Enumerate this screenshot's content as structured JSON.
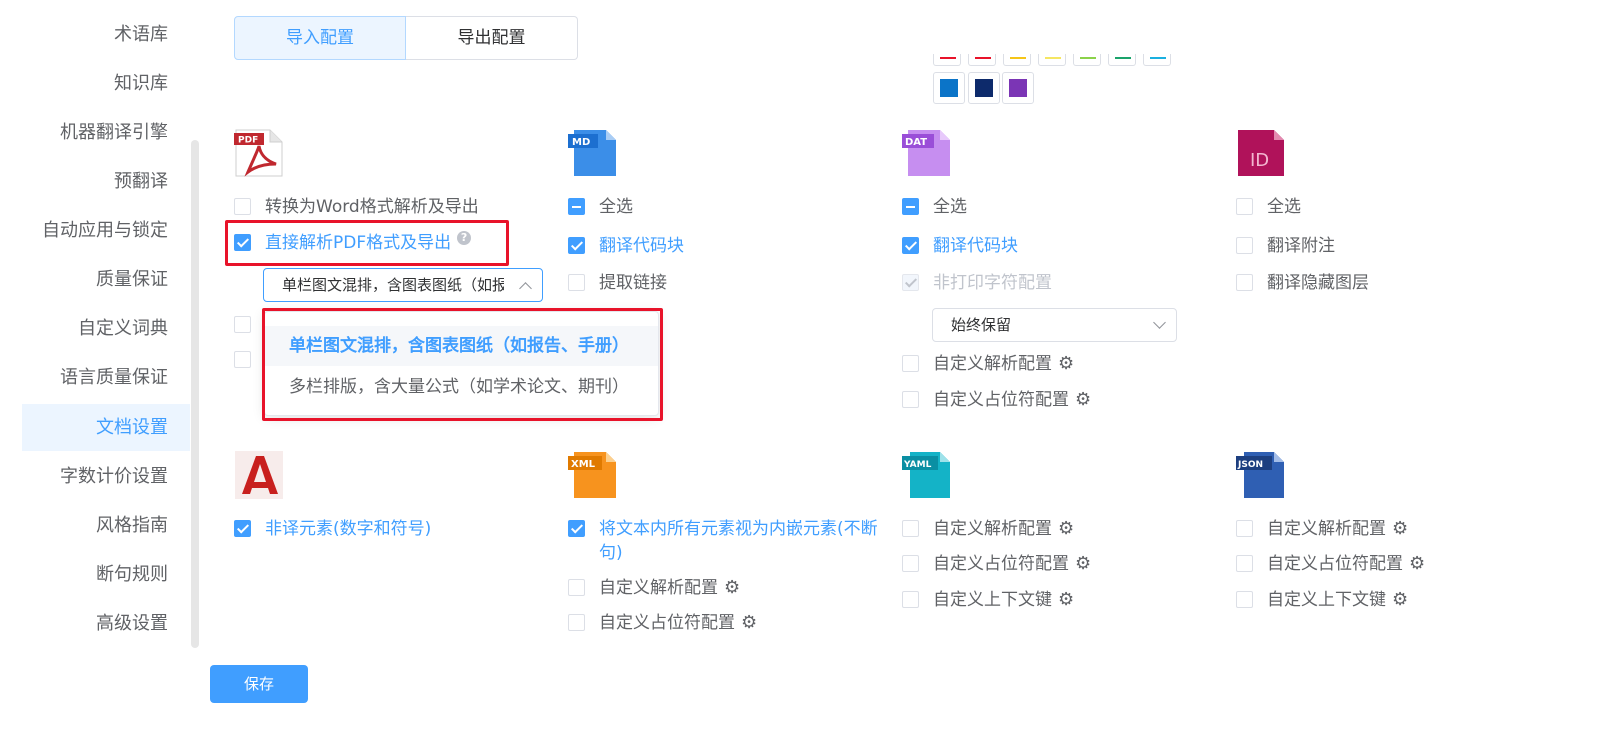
{
  "sidebar": {
    "items": [
      {
        "label": "术语库"
      },
      {
        "label": "知识库"
      },
      {
        "label": "机器翻译引擎"
      },
      {
        "label": "预翻译"
      },
      {
        "label": "自动应用与锁定"
      },
      {
        "label": "质量保证"
      },
      {
        "label": "自定义词典"
      },
      {
        "label": "语言质量保证"
      },
      {
        "label": "文档设置",
        "active": true
      },
      {
        "label": "字数计价设置"
      },
      {
        "label": "风格指南"
      },
      {
        "label": "断句规则"
      },
      {
        "label": "高级设置"
      }
    ]
  },
  "tabs": {
    "import": "导入配置",
    "export": "导出配置"
  },
  "colors": {
    "top_row": [
      "#e8132a",
      "#e8132a",
      "#f5c518",
      "#f5e663",
      "#8bd24a",
      "#1aa36b",
      "#1ab0e0"
    ],
    "bottom_row": [
      "#0b74c8",
      "#0d2a6b",
      "#7b35b5"
    ]
  },
  "file_icons": {
    "pdf": "PDF",
    "md": "MD",
    "dat": "DAT",
    "indesign": "ID",
    "xml": "XML",
    "yaml": "YAML",
    "json": "JSON"
  },
  "pdf": {
    "word_convert": "转换为Word格式解析及导出",
    "direct_parse": "直接解析PDF格式及导出",
    "mode_select": "单栏图文混排，含图表图纸（如报告、手册）",
    "options": [
      "单栏图文混排，含图表图纸（如报告、手册）",
      "多栏排版，含大量公式（如学术论文、期刊）"
    ]
  },
  "md": {
    "select_all": "全选",
    "translate_code": "翻译代码块",
    "extract_links": "提取链接"
  },
  "dat": {
    "select_all": "全选",
    "translate_code": "翻译代码块",
    "nonprint": "非打印字符配置",
    "keep_select": "始终保留",
    "custom_parse": "自定义解析配置",
    "custom_placeholder": "自定义占位符配置"
  },
  "indesign": {
    "select_all": "全选",
    "translate_notes": "翻译附注",
    "translate_hidden": "翻译隐藏图层"
  },
  "autocad": {
    "non_translate": "非译元素(数字和符号)"
  },
  "xml": {
    "inline_line1": "将文本内所有元素视为内嵌元素(不断",
    "inline_line2": "句)",
    "custom_parse": "自定义解析配置",
    "custom_placeholder": "自定义占位符配置"
  },
  "yaml": {
    "custom_parse": "自定义解析配置",
    "custom_placeholder": "自定义占位符配置",
    "custom_context": "自定义上下文键"
  },
  "json": {
    "custom_parse": "自定义解析配置",
    "custom_placeholder": "自定义占位符配置",
    "custom_context": "自定义上下文键"
  },
  "save_label": "保存"
}
